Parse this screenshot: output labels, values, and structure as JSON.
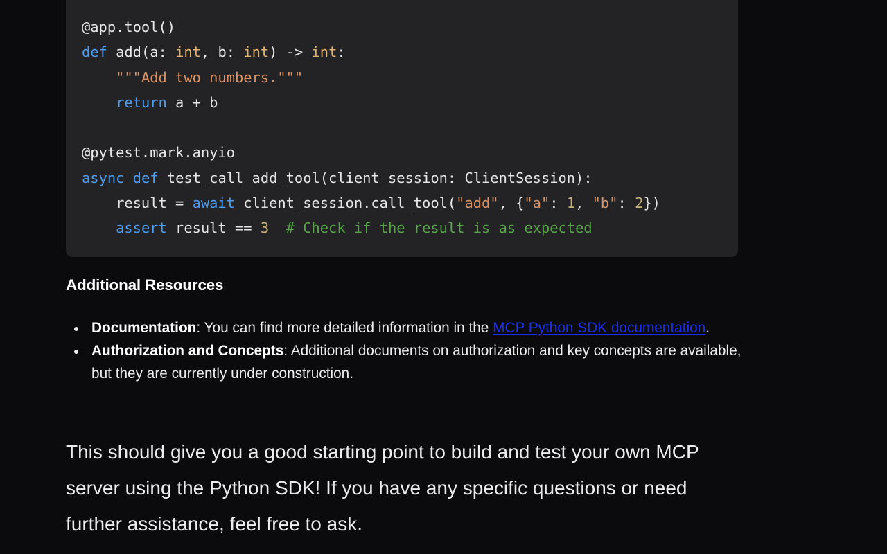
{
  "code": {
    "lines": [
      [
        {
          "t": "@app.tool()",
          "c": "plain"
        }
      ],
      [
        {
          "t": "def",
          "c": "kw"
        },
        {
          "t": " add(a: ",
          "c": "plain"
        },
        {
          "t": "int",
          "c": "ty"
        },
        {
          "t": ", b: ",
          "c": "plain"
        },
        {
          "t": "int",
          "c": "ty"
        },
        {
          "t": ") -> ",
          "c": "plain"
        },
        {
          "t": "int",
          "c": "ty"
        },
        {
          "t": ":",
          "c": "plain"
        }
      ],
      [
        {
          "t": "    ",
          "c": "plain"
        },
        {
          "t": "\"\"\"Add two numbers.\"\"\"",
          "c": "str"
        }
      ],
      [
        {
          "t": "    ",
          "c": "plain"
        },
        {
          "t": "return",
          "c": "kw"
        },
        {
          "t": " a + b",
          "c": "plain"
        }
      ],
      [
        {
          "t": "",
          "c": "plain"
        }
      ],
      [
        {
          "t": "@pytest.mark.anyio",
          "c": "plain"
        }
      ],
      [
        {
          "t": "async",
          "c": "kw"
        },
        {
          "t": " ",
          "c": "plain"
        },
        {
          "t": "def",
          "c": "kw"
        },
        {
          "t": " test_call_add_tool(client_session: ClientSession):",
          "c": "plain"
        }
      ],
      [
        {
          "t": "    result = ",
          "c": "plain"
        },
        {
          "t": "await",
          "c": "kw"
        },
        {
          "t": " client_session.call_tool(",
          "c": "plain"
        },
        {
          "t": "\"add\"",
          "c": "str"
        },
        {
          "t": ", {",
          "c": "plain"
        },
        {
          "t": "\"a\"",
          "c": "str"
        },
        {
          "t": ": ",
          "c": "plain"
        },
        {
          "t": "1",
          "c": "num"
        },
        {
          "t": ", ",
          "c": "plain"
        },
        {
          "t": "\"b\"",
          "c": "str"
        },
        {
          "t": ": ",
          "c": "plain"
        },
        {
          "t": "2",
          "c": "num"
        },
        {
          "t": "})",
          "c": "plain"
        }
      ],
      [
        {
          "t": "    ",
          "c": "plain"
        },
        {
          "t": "assert",
          "c": "kw"
        },
        {
          "t": " result == ",
          "c": "plain"
        },
        {
          "t": "3",
          "c": "num"
        },
        {
          "t": "  ",
          "c": "plain"
        },
        {
          "t": "# Check if the result is as expected",
          "c": "cm"
        }
      ]
    ]
  },
  "resources": {
    "heading": "Additional Resources",
    "items": [
      {
        "label": "Documentation",
        "text_before_link": ": You can find more detailed information in the ",
        "link_text": "MCP Python SDK documentation",
        "text_after_link": "."
      },
      {
        "label": "Authorization and Concepts",
        "text": ": Additional documents on authorization and key concepts are available, but they are currently under construction."
      }
    ]
  },
  "closing": "This should give you a good starting point to build and test your own MCP server using the Python SDK! If you have any specific questions or need further assistance, feel free to ask.",
  "colors": {
    "background": "#0b0b0d",
    "code_background": "#232325",
    "keyword": "#4d9cf0",
    "type": "#e2b26e",
    "string": "#d99266",
    "comment": "#58a64a",
    "link": "#1a2ef0"
  }
}
